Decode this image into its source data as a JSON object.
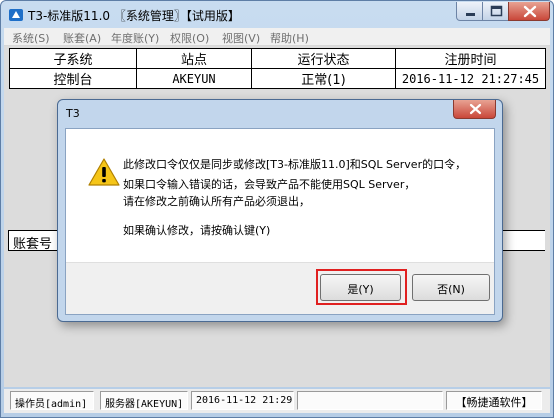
{
  "window": {
    "title": "T3-标准版11.0 〖系统管理〗【试用版】"
  },
  "menu": [
    "系统(S)",
    "账套(A)",
    "年度账(Y)",
    "权限(O)",
    "视图(V)",
    "帮助(H)"
  ],
  "grid": {
    "headers": [
      "子系统",
      "站点",
      "运行状态",
      "注册时间"
    ],
    "rows": [
      [
        "控制台",
        "AKEYUN",
        "正常(1)",
        "2016-11-12 21:27:45"
      ]
    ]
  },
  "ledger_label": "账套号",
  "statusbar": {
    "operator": "操作员[admin]",
    "server": "服务器[AKEYUN]",
    "datetime": "2016-11-12 21:29",
    "version": "【畅捷通软件】"
  },
  "dialog": {
    "title": "T3",
    "icon": "warning-icon",
    "message_lines": [
      "此修改口令仅仅是同步或修改[T3-标准版11.0]和SQL Server的口令，",
      "如果口令输入错误的话，会导致产品不能使用SQL Server，",
      "请在修改之前确认所有产品必须退出，",
      "如果确认修改，请按确认键(Y)"
    ],
    "yes_label": "是(Y)",
    "no_label": "否(N)",
    "highlight_color": "#e02020"
  },
  "colors": {
    "close_button": "#c9473a",
    "window_frame": "#b6cde6"
  }
}
